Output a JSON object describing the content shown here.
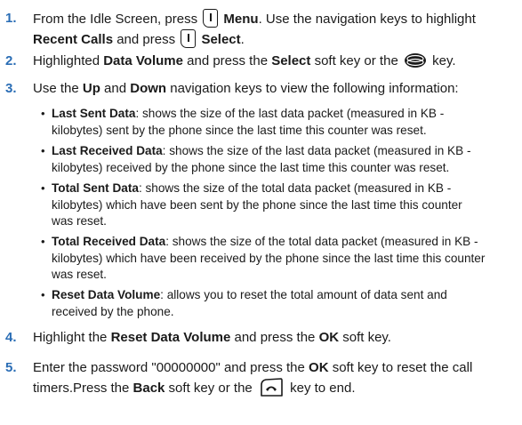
{
  "steps": [
    {
      "num": "1.",
      "t1": "From the Idle Screen, press",
      "t1b": "Menu",
      "t2": ". Use the navigation keys to highlight",
      "t3b": "Recent Calls",
      "t4": " and press",
      "t4b": "Select",
      "t5": "."
    },
    {
      "num": "2.",
      "t1": "Highlighted ",
      "t1b": "Data Volume",
      "t2": " and press the ",
      "t2b": "Select",
      "t3": " soft key or the",
      "t4": "key."
    },
    {
      "num": "3.",
      "t1": "Use the ",
      "t1b": "Up",
      "t2": " and ",
      "t2b": "Down",
      "t3": " navigation keys to view the following information:"
    },
    {
      "num": "4.",
      "t1": "Highlight the ",
      "t1b": "Reset Data Volume",
      "t2": " and press the ",
      "t2b": "OK",
      "t3": " soft key."
    },
    {
      "num": "5.",
      "t1": "Enter the password \"00000000\" and press the ",
      "t1b": "OK",
      "t2": " soft key to reset the call",
      "t3": "timers.Press the ",
      "t3b": "Back",
      "t4": " soft key or the",
      "t5": "key to end."
    }
  ],
  "bullets": [
    {
      "label": "Last Sent Data",
      "l1": ": shows the size of the last data packet (measured in KB -",
      "l2": "kilobytes) sent by the phone since the last time this counter was reset."
    },
    {
      "label": "Last Received Data",
      "l1": ": shows the size of the last data packet (measured in KB -",
      "l2": "kilobytes) received by the phone since the last time this counter was reset."
    },
    {
      "label": "Total Sent Data",
      "l1": ": shows the size of the total data packet (measured in KB -",
      "l2": "kilobytes) which have been sent by the phone since the last time this counter",
      "l3": "was reset."
    },
    {
      "label": "Total Received Data",
      "l1": ": shows the size of the total data packet (measured in KB -",
      "l2": "kilobytes) which have been received by the phone since the last time this counter",
      "l3": "was reset."
    },
    {
      "label": "Reset Data Volume",
      "l1": ": allows you to reset the total amount of data sent and",
      "l2": "received by the phone."
    }
  ]
}
